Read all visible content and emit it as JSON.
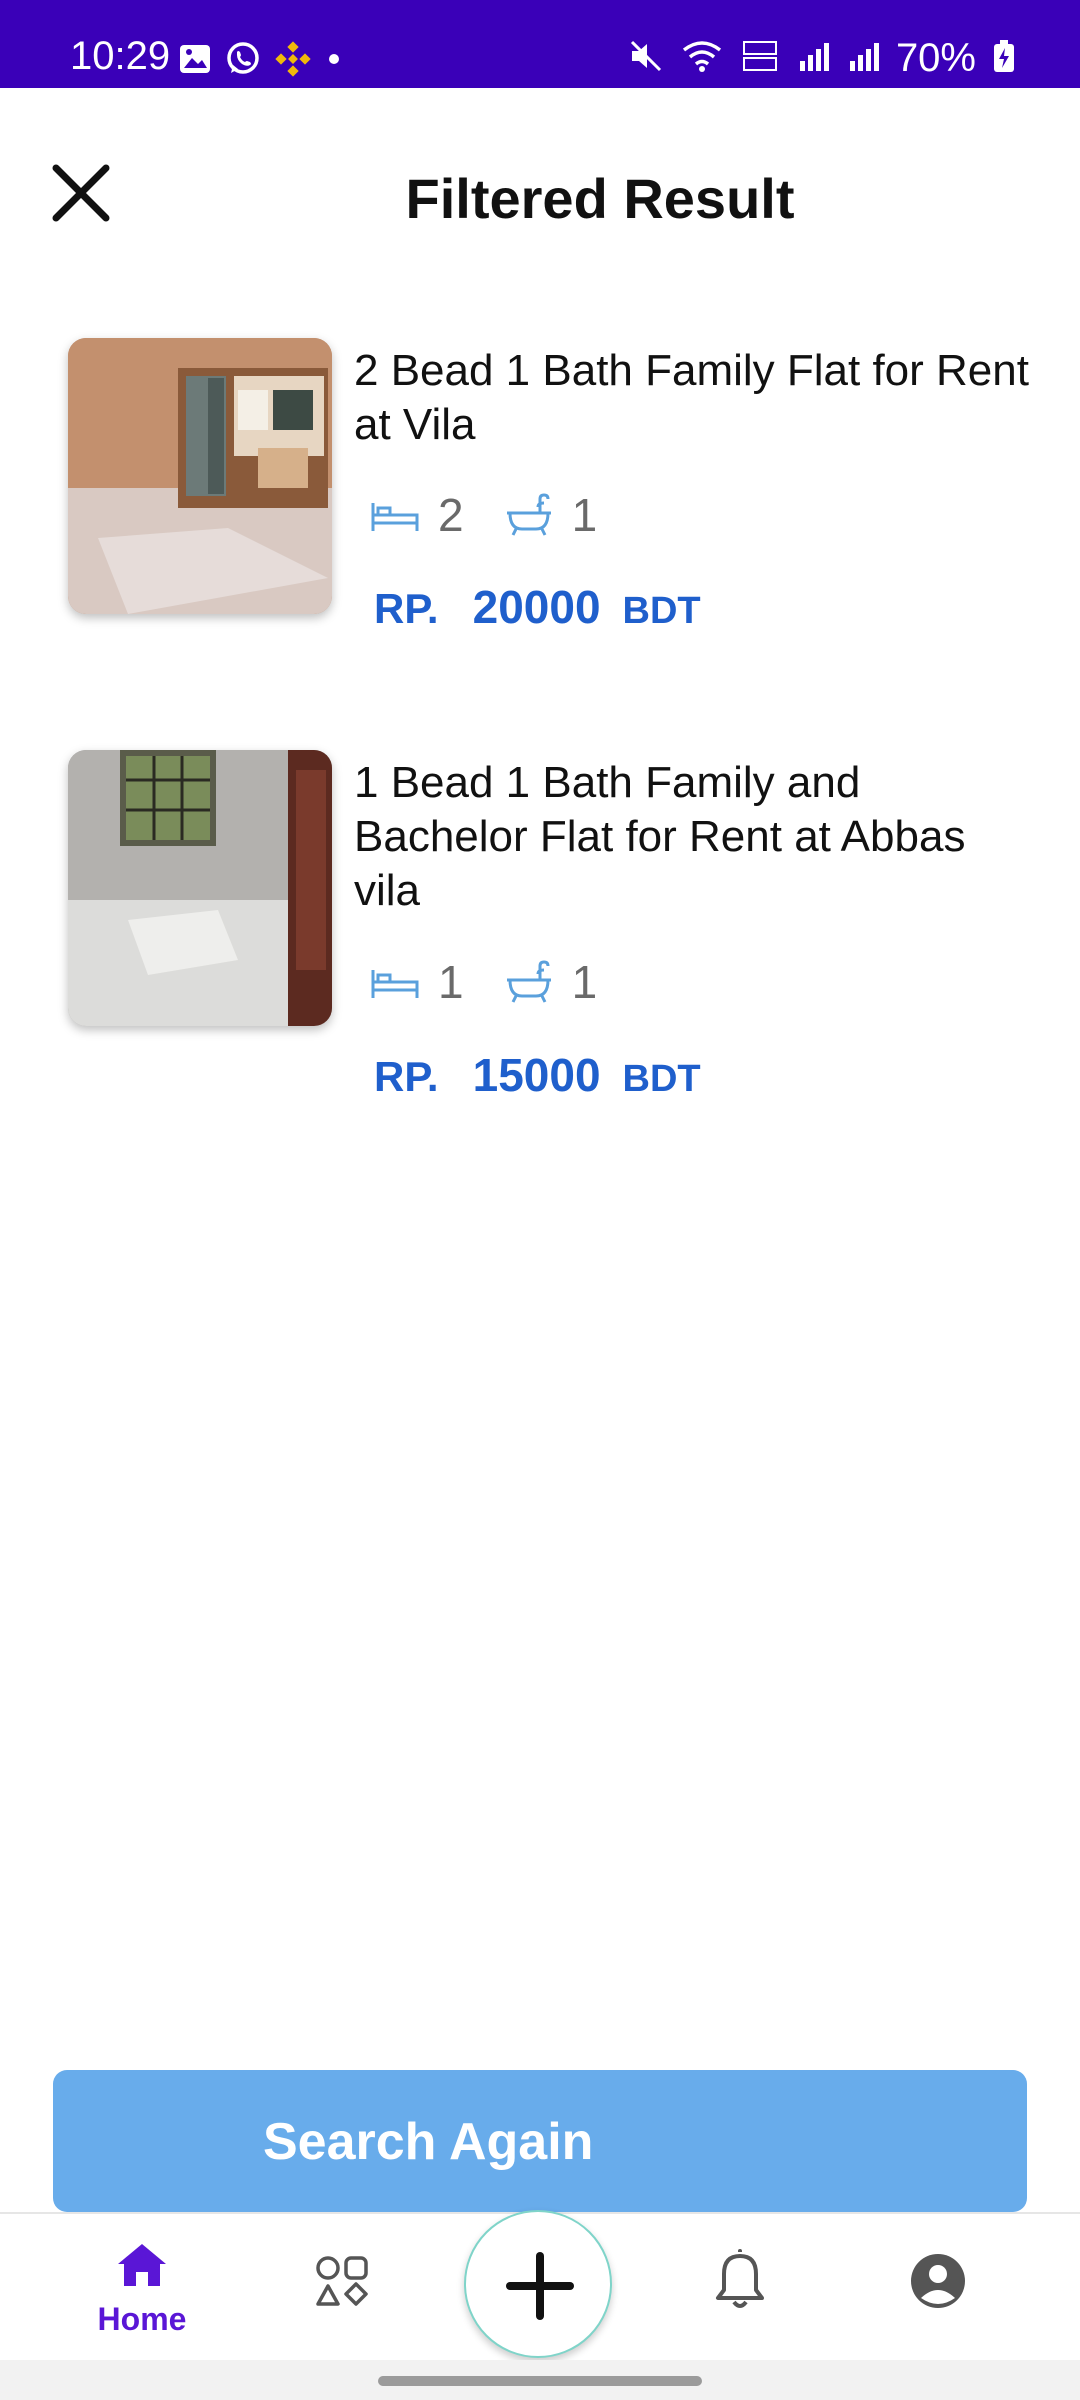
{
  "status_bar": {
    "time": "10:29",
    "battery": "70%",
    "background": "#3a00b8"
  },
  "header": {
    "title": "Filtered Result",
    "close_icon": "close-icon"
  },
  "listings": [
    {
      "title": "2 Bead 1 Bath Family Flat for Rent at Vila",
      "beds": "2",
      "baths": "1",
      "price_prefix": "RP.",
      "price": "20000",
      "currency": "BDT"
    },
    {
      "title": "1 Bead 1 Bath Family and Bachelor Flat for Rent at Abbas vila",
      "beds": "1",
      "baths": "1",
      "price_prefix": "RP.",
      "price": "15000",
      "currency": "BDT"
    }
  ],
  "search_again_label": "Search Again",
  "bottom_nav": {
    "home_label": "Home",
    "items": [
      "home-icon",
      "categories-icon",
      "add-icon",
      "bell-icon",
      "profile-icon"
    ]
  },
  "colors": {
    "accent": "#5a16d6",
    "price": "#1f5fcc",
    "button": "#68aceb",
    "icon_blue": "#5aa0dc"
  }
}
